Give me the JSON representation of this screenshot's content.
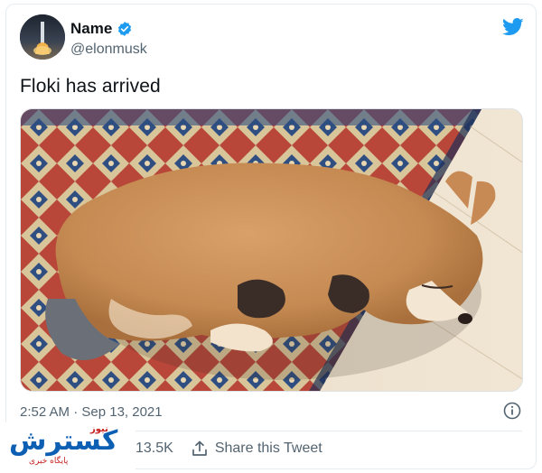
{
  "tweet": {
    "author_name": "Name",
    "handle": "@elonmusk",
    "text": "Floki has arrived",
    "timestamp": "2:52 AM · Sep 13, 2021",
    "likes_count": "13.5K",
    "share_label": "Share this Tweet"
  },
  "icons": {
    "verified": "verified-badge-icon",
    "platform": "twitter-bird-icon",
    "info": "info-icon",
    "share": "share-icon"
  },
  "watermark": {
    "main": "کسترش",
    "tag": "نیوز",
    "sub": "پایگاه خبری"
  },
  "colors": {
    "brand_blue": "#1d9bf0",
    "text_primary": "#0f1419",
    "text_secondary": "#536471",
    "watermark_blue": "#0d5fb4",
    "watermark_red": "#c62020"
  }
}
